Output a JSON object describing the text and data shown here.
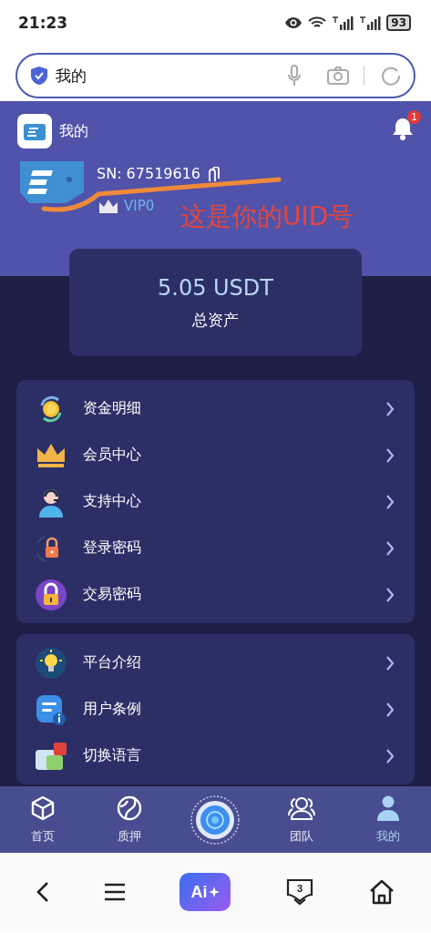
{
  "status_bar": {
    "time": "21:23",
    "battery": "93"
  },
  "address_bar": {
    "text": "我的"
  },
  "header": {
    "title": "我的",
    "notification_count": "1"
  },
  "profile": {
    "sn": "SN: 67519616",
    "vip": "VIP0"
  },
  "annotation": {
    "text": "这是你的UID号"
  },
  "assets": {
    "amount": "5.05 USDT",
    "label": "总资产"
  },
  "menu_groups": [
    {
      "items": [
        {
          "label": "资金明细"
        },
        {
          "label": "会员中心"
        },
        {
          "label": "支持中心"
        },
        {
          "label": "登录密码"
        },
        {
          "label": "交易密码"
        }
      ]
    },
    {
      "items": [
        {
          "label": "平台介绍"
        },
        {
          "label": "用户条例"
        },
        {
          "label": "切换语言"
        }
      ]
    }
  ],
  "tab_bar": [
    {
      "kind": "tab",
      "label": "首页",
      "selected": false
    },
    {
      "kind": "tab",
      "label": "质押",
      "selected": false
    },
    {
      "kind": "orb"
    },
    {
      "kind": "tab",
      "label": "团队",
      "selected": false
    },
    {
      "kind": "tab",
      "label": "我的",
      "selected": true
    }
  ],
  "browser_toolbar": {
    "ai_label": "Ai",
    "tab_count": "3"
  }
}
